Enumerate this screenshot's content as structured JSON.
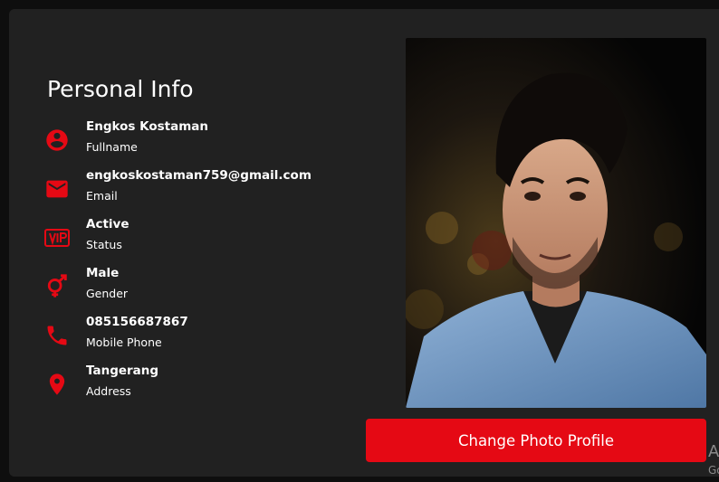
{
  "personal_info": {
    "title": "Personal Info",
    "items": [
      {
        "icon": "account-circle-icon",
        "value": "Engkos Kostaman",
        "label": "Fullname"
      },
      {
        "icon": "email-icon",
        "value": "engkoskostaman759@gmail.com",
        "label": "Email"
      },
      {
        "icon": "vip-icon",
        "value": "Active",
        "label": "Status"
      },
      {
        "icon": "gender-icon",
        "value": "Male",
        "label": "Gender"
      },
      {
        "icon": "phone-icon",
        "value": "085156687867",
        "label": "Mobile Phone"
      },
      {
        "icon": "location-pin-icon",
        "value": "Tangerang",
        "label": "Address"
      }
    ]
  },
  "profile": {
    "change_photo_label": "Change Photo Profile"
  },
  "watermark": {
    "line1": "A",
    "line2": "Go"
  },
  "colors": {
    "accent": "#e50914",
    "card_background": "#212121",
    "page_background": "#0e0e0e",
    "text": "#ffffff"
  }
}
